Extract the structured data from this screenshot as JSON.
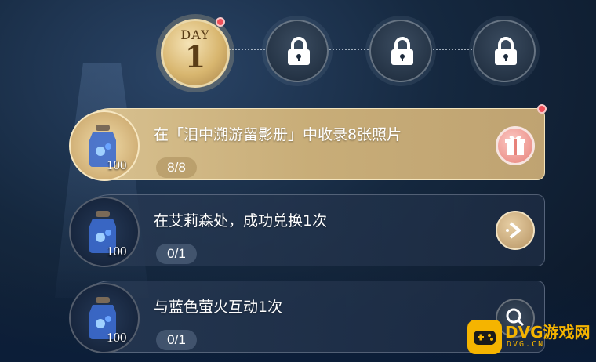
{
  "day_track": {
    "current": {
      "label": "DAY",
      "number": "1"
    },
    "locked_count": 3
  },
  "tasks": [
    {
      "title": "在「泪中溯游留影册」中收录8张照片",
      "quantity": "100",
      "progress": "8/8",
      "state": "claimable",
      "action_icon": "gift-icon"
    },
    {
      "title": "在艾莉森处，成功兑换1次",
      "quantity": "100",
      "progress": "0/1",
      "state": "in-progress",
      "action_icon": "go-arrow-icon"
    },
    {
      "title": "与蓝色萤火互动1次",
      "quantity": "100",
      "progress": "0/1",
      "state": "in-progress",
      "action_icon": "search-icon"
    }
  ],
  "watermark": {
    "name": "DVG游戏网",
    "url": "DVG.CN"
  },
  "colors": {
    "gold": "#d9c291",
    "alert_red": "#f0505a",
    "brand_yellow": "#f5b400"
  }
}
